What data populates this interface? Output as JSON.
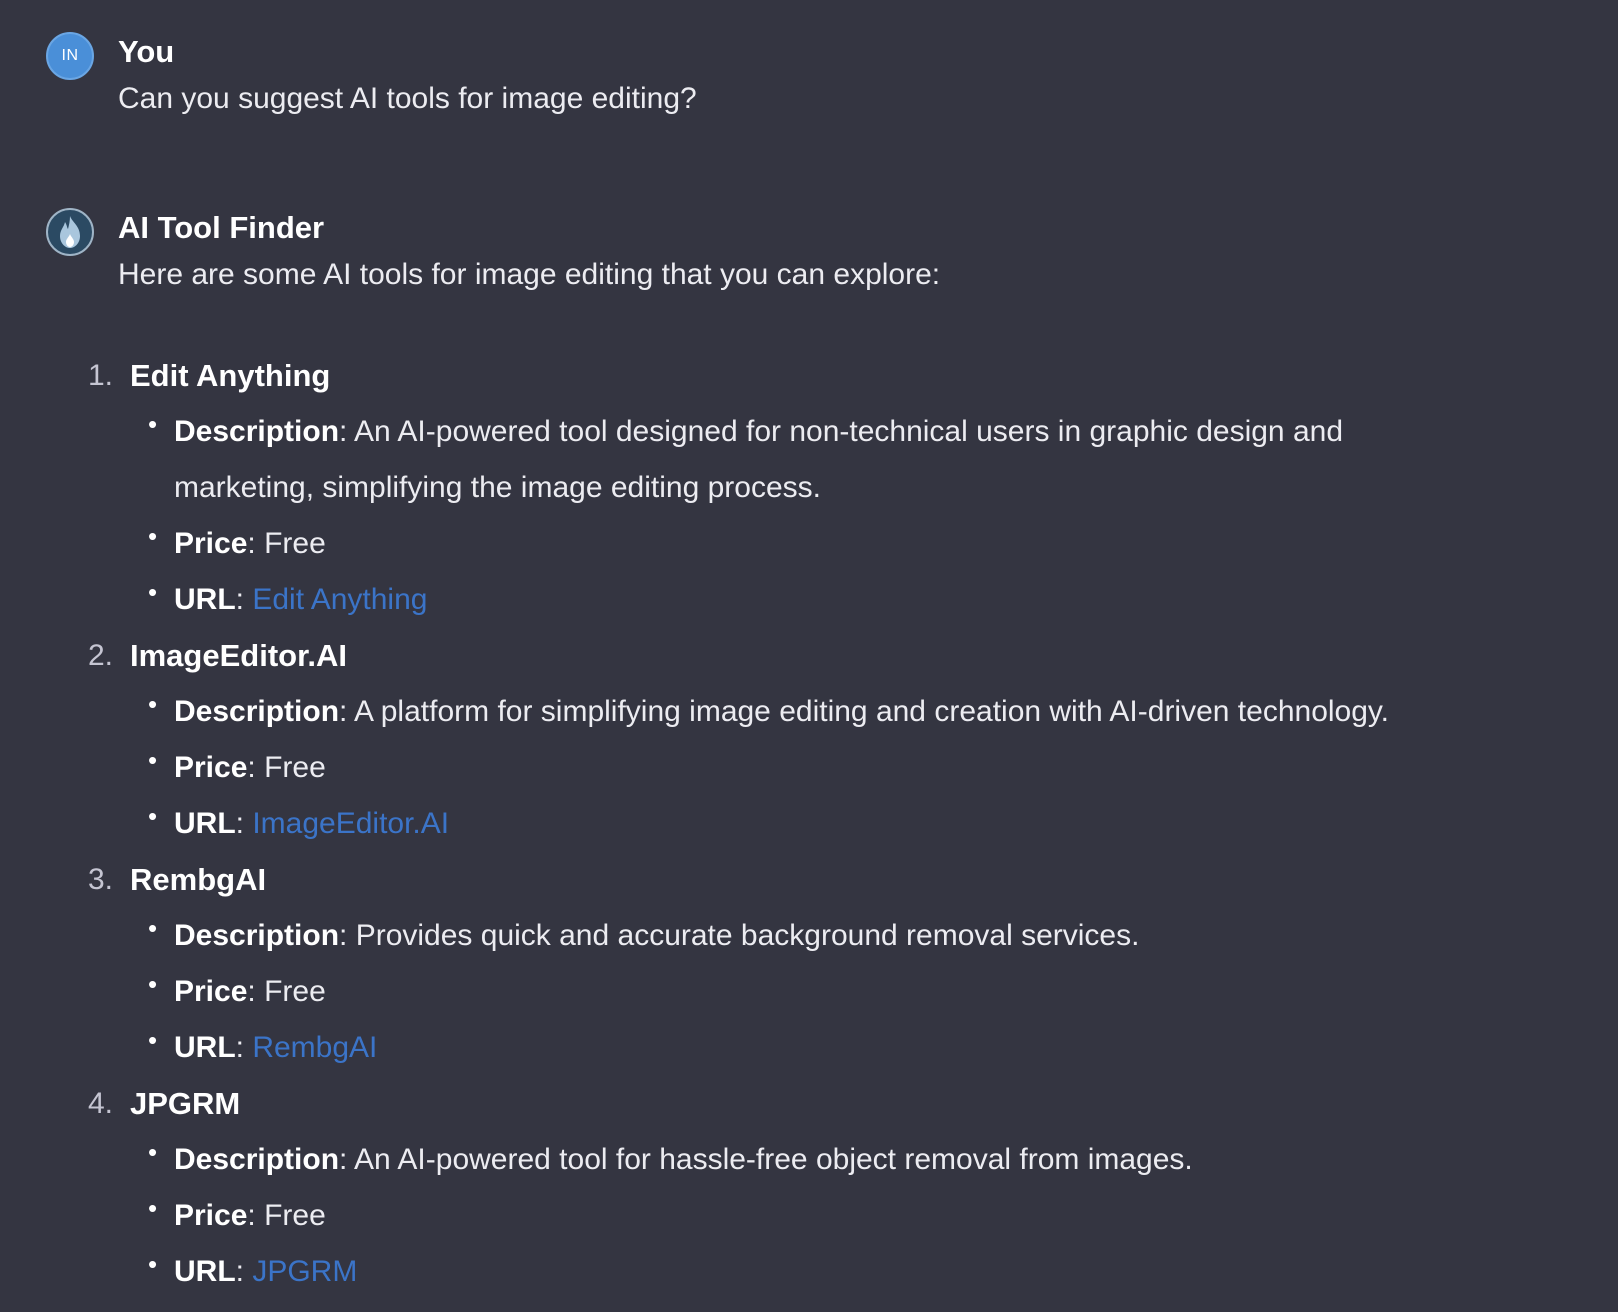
{
  "user_message": {
    "avatar_initials": "IN",
    "author": "You",
    "text": "Can you suggest AI tools for image editing?"
  },
  "bot_message": {
    "avatar_icon": "flame-icon",
    "author": "AI Tool Finder",
    "intro": "Here are some AI tools for image editing that you can explore:",
    "tools": [
      {
        "number": "1.",
        "name": "Edit Anything",
        "description_label": "Description",
        "description": "An AI-powered tool designed for non-technical users in graphic design and marketing, simplifying the image editing process.",
        "price_label": "Price",
        "price": "Free",
        "url_label": "URL",
        "url_text": "Edit Anything"
      },
      {
        "number": "2.",
        "name": "ImageEditor.AI",
        "description_label": "Description",
        "description": "A platform for simplifying image editing and creation with AI-driven technology.",
        "price_label": "Price",
        "price": "Free",
        "url_label": "URL",
        "url_text": "ImageEditor.AI"
      },
      {
        "number": "3.",
        "name": "RembgAI",
        "description_label": "Description",
        "description": "Provides quick and accurate background removal services.",
        "price_label": "Price",
        "price": "Free",
        "url_label": "URL",
        "url_text": "RembgAI"
      },
      {
        "number": "4.",
        "name": "JPGRM",
        "description_label": "Description",
        "description": "An AI-powered tool for hassle-free object removal from images.",
        "price_label": "Price",
        "price": "Free",
        "url_label": "URL",
        "url_text": "JPGRM"
      }
    ]
  },
  "colors": {
    "background": "#343541",
    "link": "#3b74c8",
    "user_avatar": "#4a8fd8"
  }
}
